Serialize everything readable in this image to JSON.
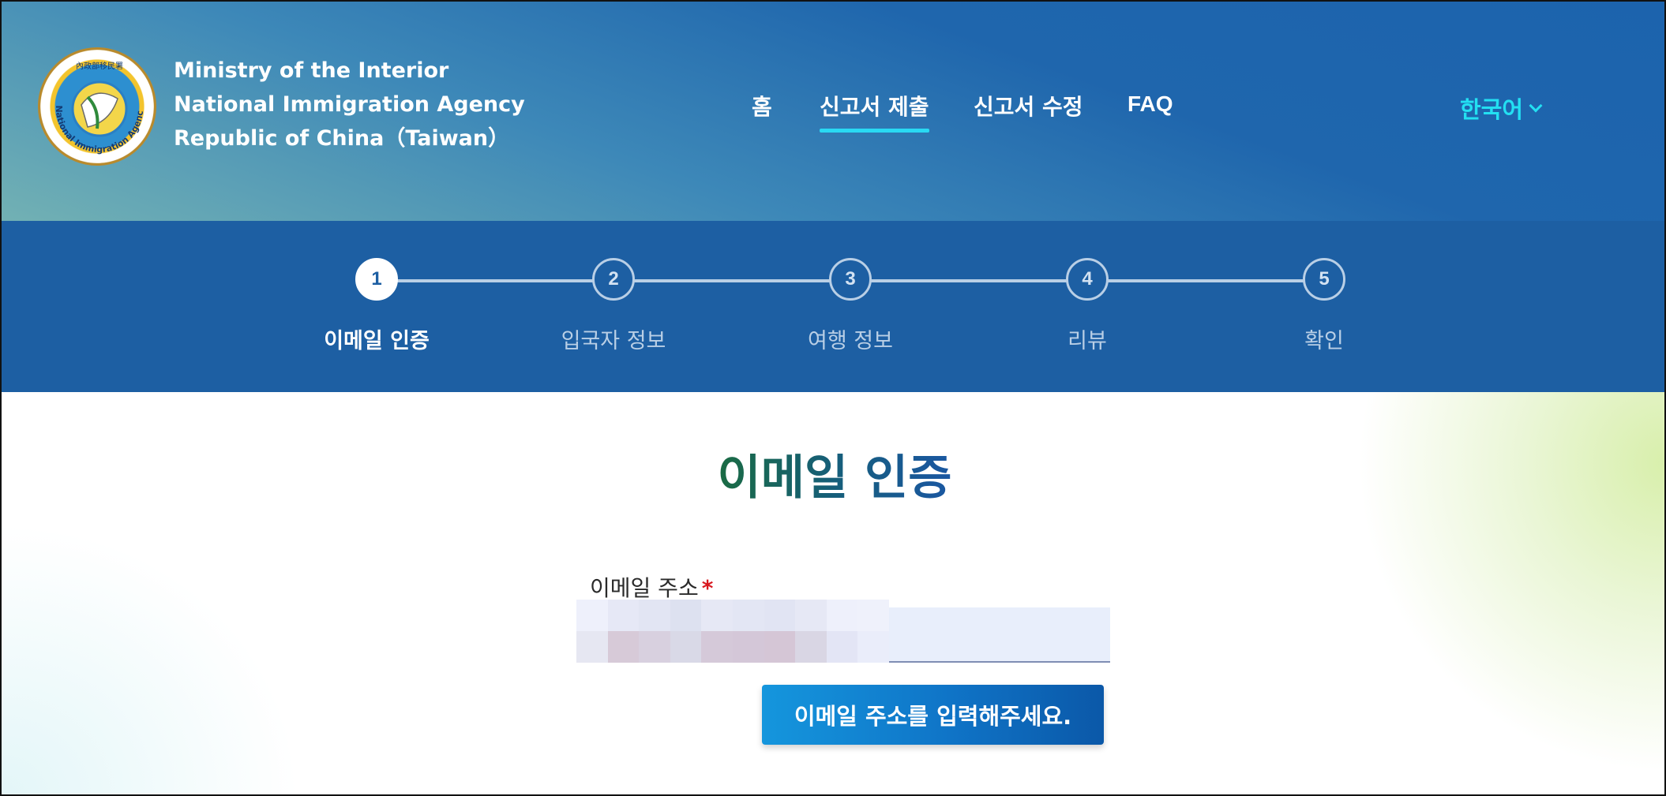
{
  "header": {
    "agency_lines": [
      "Ministry of the Interior",
      "National Immigration Agency",
      "Republic of China（Taiwan）"
    ],
    "logo_ring_text": "National Immigration Agency",
    "logo_top_text": "內政部移民署",
    "nav": [
      {
        "label": "홈",
        "active": false
      },
      {
        "label": "신고서 제출",
        "active": true
      },
      {
        "label": "신고서 수정",
        "active": false
      },
      {
        "label": "FAQ",
        "active": false
      }
    ],
    "language": "한국어",
    "colors": {
      "nav_active_underline": "#29d9f3",
      "language_text": "#23e0f2"
    }
  },
  "stepper": {
    "steps": [
      {
        "number": "1",
        "label": "이메일 인증",
        "active": true
      },
      {
        "number": "2",
        "label": "입국자 정보",
        "active": false
      },
      {
        "number": "3",
        "label": "여행 정보",
        "active": false
      },
      {
        "number": "4",
        "label": "리뷰",
        "active": false
      },
      {
        "number": "5",
        "label": "확인",
        "active": false
      }
    ],
    "background": "#1d5fa3"
  },
  "form": {
    "title": "이메일 인증",
    "email_label": "이메일 주소",
    "required_mark": "*",
    "email_value": "",
    "email_placeholder": "",
    "submit_label": "이메일 주소를 입력해주세요."
  }
}
